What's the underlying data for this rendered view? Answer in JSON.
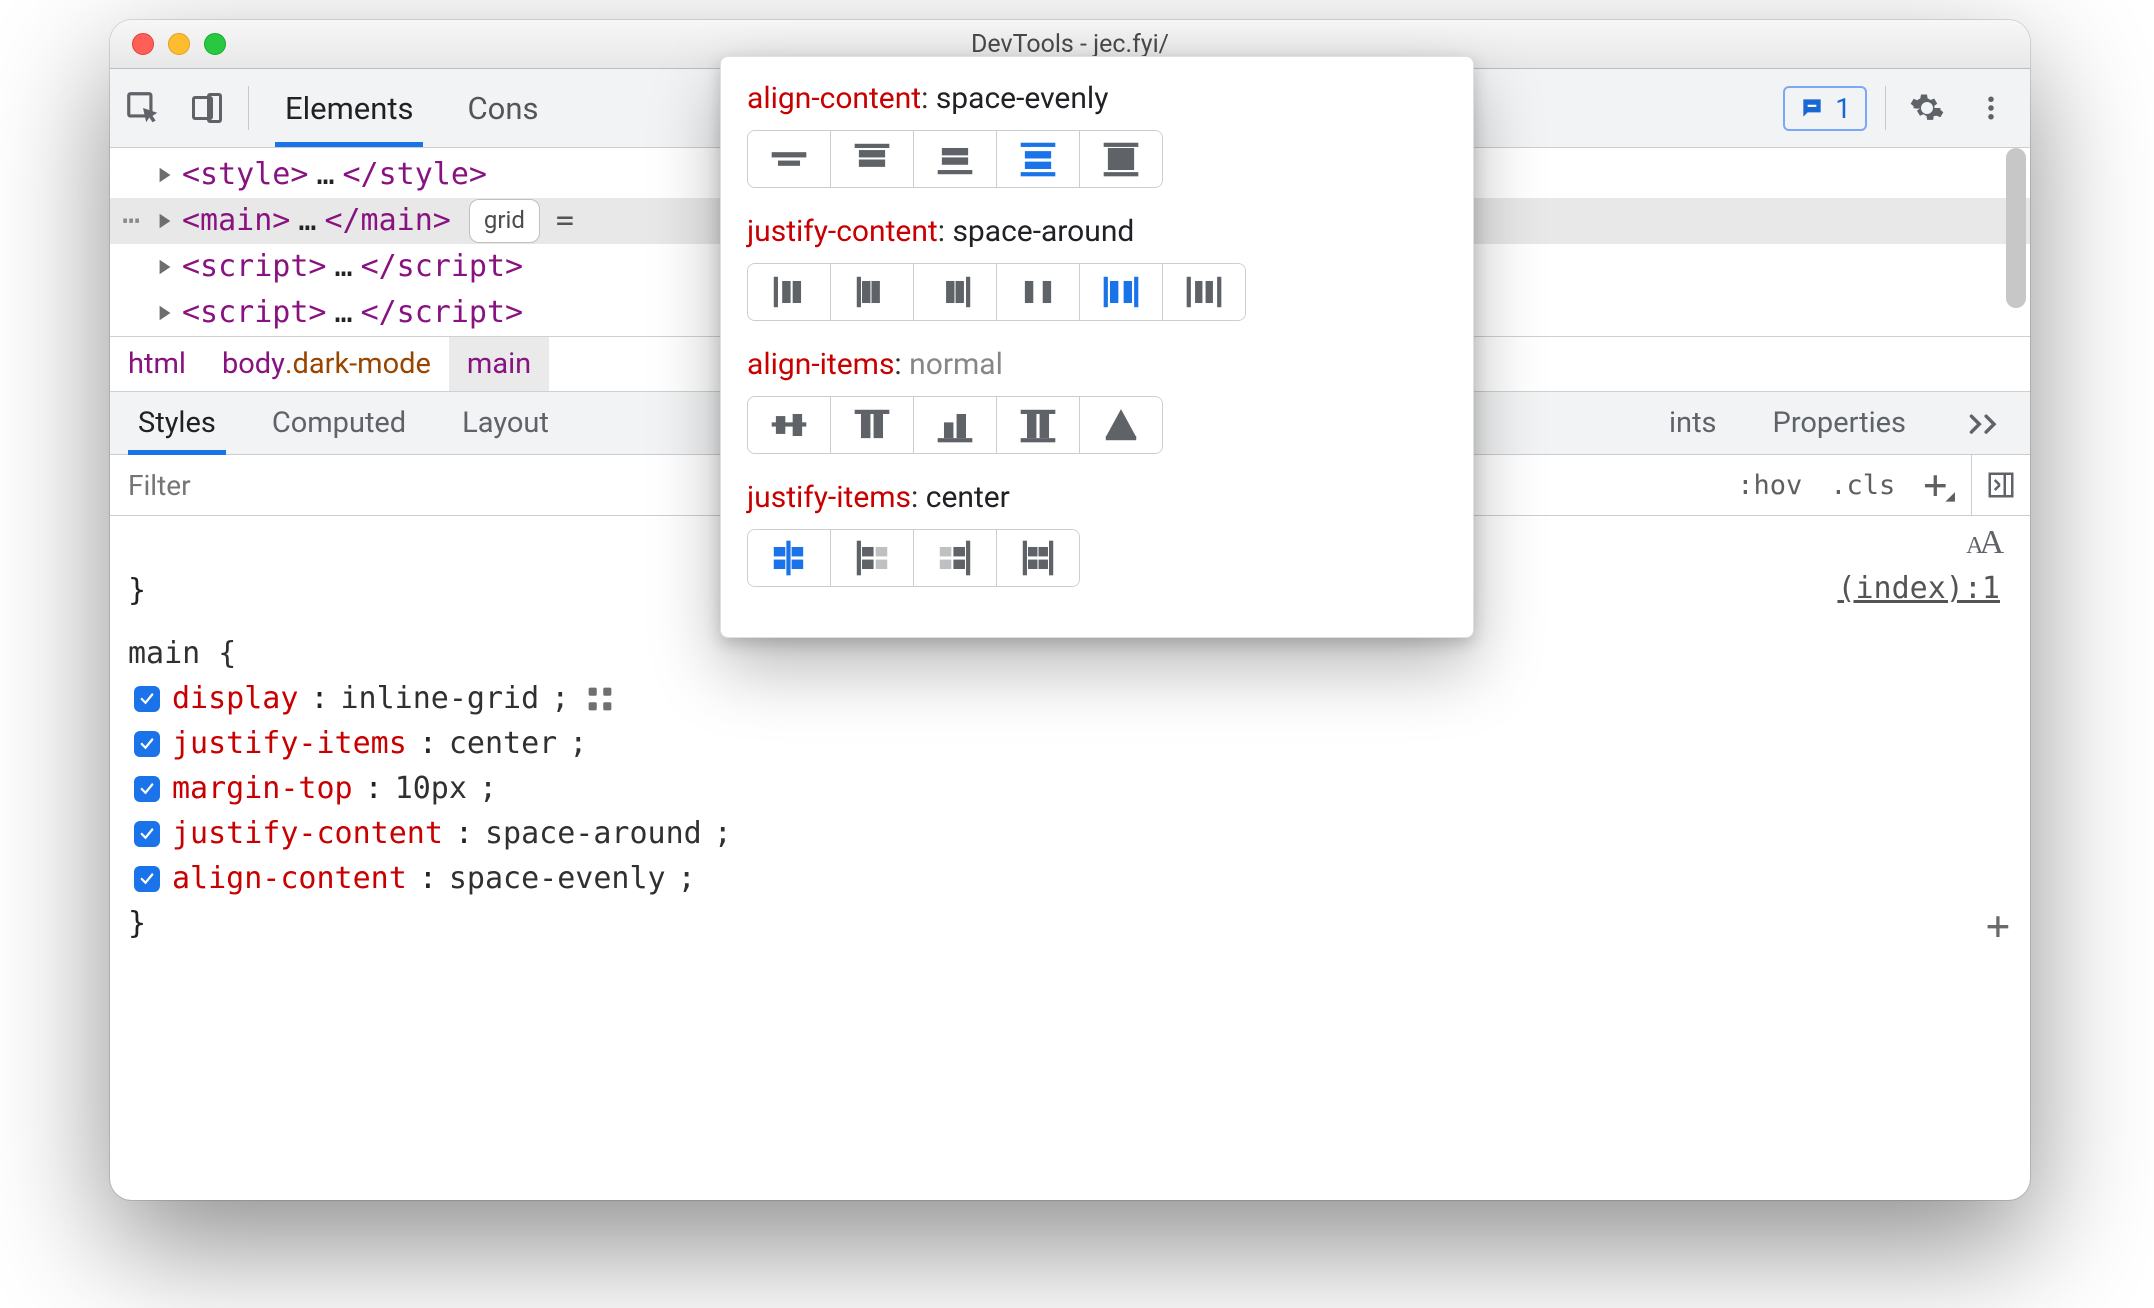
{
  "window": {
    "title": "DevTools - jec.fyi/"
  },
  "toolbar": {
    "tabs": {
      "elements": "Elements",
      "console": "Cons"
    },
    "feedback_count": "1"
  },
  "dom": {
    "rows": [
      {
        "open": "<style>",
        "mid": "…",
        "close": "</style>"
      },
      {
        "open": "<main>",
        "mid": "…",
        "close": "</main>",
        "badge": "grid",
        "selected": true,
        "eq": "="
      },
      {
        "open": "<script>",
        "mid": "…",
        "close": "</script>"
      },
      {
        "open": "<script>",
        "mid": "…",
        "close": "</script>"
      }
    ]
  },
  "breadcrumb": {
    "a": "html",
    "b_el": "body",
    "b_cls": ".dark-mode",
    "c": "main"
  },
  "subtabs": {
    "styles": "Styles",
    "computed": "Computed",
    "layout": "Layout",
    "ints_partial": "ints",
    "properties": "Properties"
  },
  "filter": {
    "placeholder": "Filter",
    "hov": ":hov",
    "cls": ".cls"
  },
  "css": {
    "brace_top": "}",
    "selector": "main {",
    "source": "(index):1",
    "decls": [
      {
        "prop": "display",
        "value": "inline-grid",
        "grid_icon": true
      },
      {
        "prop": "justify-items",
        "value": "center"
      },
      {
        "prop": "margin-top",
        "value": "10px"
      },
      {
        "prop": "justify-content",
        "value": "space-around"
      },
      {
        "prop": "align-content",
        "value": "space-evenly"
      }
    ],
    "brace_bottom": "}"
  },
  "popover": {
    "sections": [
      {
        "prop": "align-content",
        "value": "space-evenly",
        "icons": "align-content",
        "selected": 3,
        "count": 5
      },
      {
        "prop": "justify-content",
        "value": "space-around",
        "icons": "justify-content",
        "selected": 4,
        "count": 6
      },
      {
        "prop": "align-items",
        "value": "normal",
        "muted": true,
        "icons": "align-items",
        "selected": -1,
        "count": 5
      },
      {
        "prop": "justify-items",
        "value": "center",
        "icons": "justify-items",
        "selected": 0,
        "count": 4
      }
    ]
  }
}
